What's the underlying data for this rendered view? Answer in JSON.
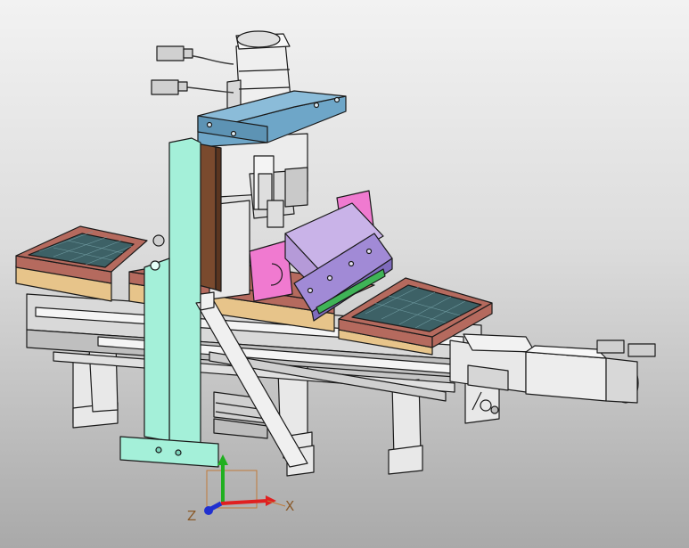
{
  "viewport": {
    "background_top": "#f2f2f2",
    "background_bottom": "#a9a9a9"
  },
  "colors": {
    "tray_red": "#b56a5e",
    "tray_tan": "#e7c48a",
    "tray_grid": "#3d6166",
    "mint_frame": "#a4f0d9",
    "brown_plate": "#7a4a2e",
    "blue_plate": "#6ea6c8",
    "pink_bracket": "#f07ad0",
    "purple_head": "#a18ad6",
    "lavender_wedge": "#c9b3e8",
    "grey_parts": "#e6e6e6",
    "outline": "#1a1a1a",
    "axis_x": "#e02020",
    "axis_y": "#20b020",
    "axis_z": "#2030d0"
  },
  "icons": [
    "servo-motor-icon",
    "connector-icon",
    "cable-icon"
  ],
  "triad": {
    "x_label": "X",
    "z_label": "Z"
  }
}
